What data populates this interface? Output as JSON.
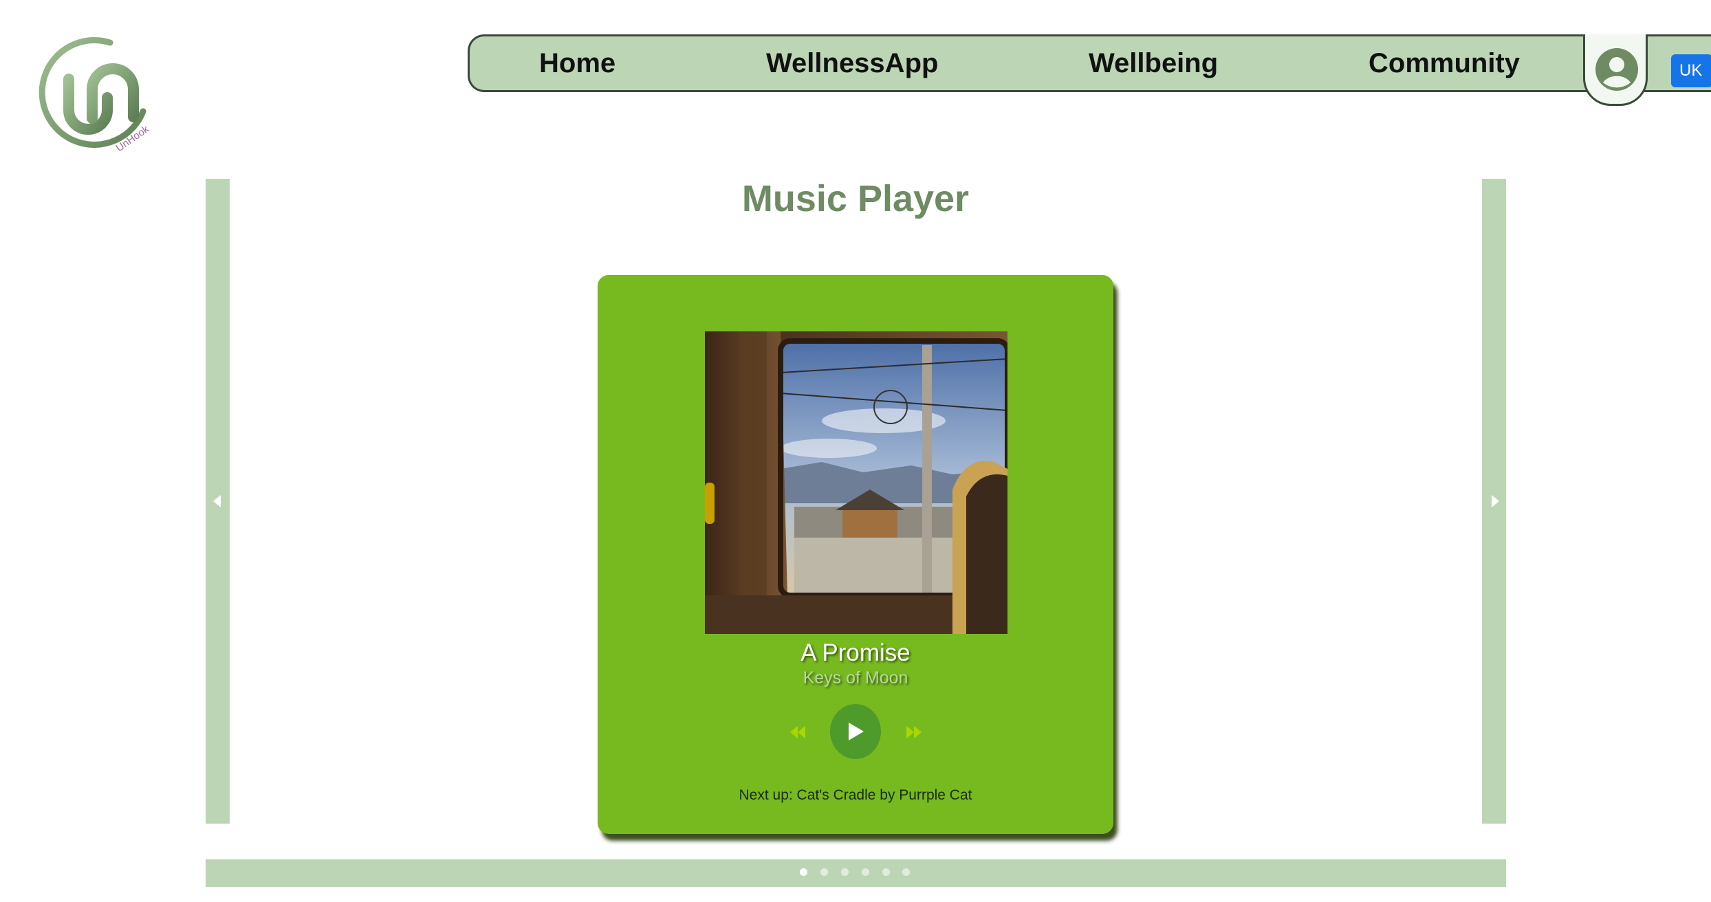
{
  "logo": {
    "text": "UnHook",
    "icon": "unhook-logo-icon"
  },
  "nav": {
    "items": [
      {
        "label": "Home"
      },
      {
        "label": "WellnessApp"
      },
      {
        "label": "Wellbeing"
      },
      {
        "label": "Community"
      }
    ],
    "profile_icon": "user-avatar-icon",
    "language": "UK"
  },
  "carousel": {
    "title": "Music Player",
    "prev_icon": "chevron-left-icon",
    "next_icon": "chevron-right-icon",
    "slide_count": 6,
    "active_slide": 1
  },
  "player": {
    "cover_icon": "album-cover-image",
    "song_title": "A Promise",
    "artist": "Keys of Moon",
    "controls": {
      "rewind_icon": "rewind-icon",
      "play_icon": "play-icon",
      "forward_icon": "fast-forward-icon"
    },
    "next_up": "Next up: Cat's Cradle by Purrple Cat"
  },
  "colors": {
    "nav_bg": "#bcd6b5",
    "player_bg": "#76ba1f",
    "title_green": "#6e8b63",
    "play_button": "#4e9a2b",
    "skip_buttons": "#a8d800",
    "lang_button": "#1575e8"
  }
}
